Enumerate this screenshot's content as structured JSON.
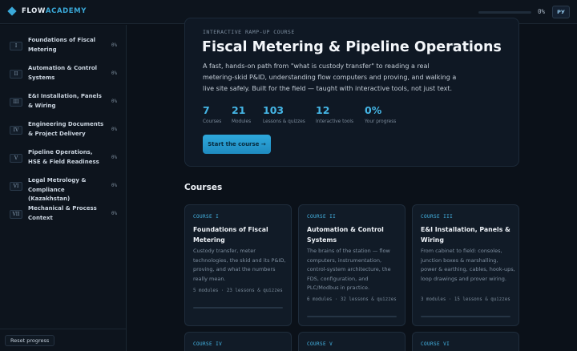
{
  "header": {
    "brand_main": "FLOW",
    "brand_accent": "ACADEMY",
    "progress_percent": 0,
    "progress_label": "0%",
    "lang_label": "РУ"
  },
  "sidebar": {
    "items": [
      {
        "num": "I",
        "label": "Foundations of Fiscal Metering",
        "pct": "0%"
      },
      {
        "num": "II",
        "label": "Automation & Control Systems",
        "pct": "0%"
      },
      {
        "num": "III",
        "label": "E&I Installation, Panels & Wiring",
        "pct": "0%"
      },
      {
        "num": "IV",
        "label": "Engineering Documents & Project Delivery",
        "pct": "0%"
      },
      {
        "num": "V",
        "label": "Pipeline Operations, HSE & Field Readiness",
        "pct": "0%"
      },
      {
        "num": "VI",
        "label": "Legal Metrology & Compliance (Kazakhstan)",
        "pct": "0%"
      },
      {
        "num": "VII",
        "label": "Mechanical & Process Context",
        "pct": "0%"
      }
    ],
    "reset_label": "Reset progress"
  },
  "hero": {
    "eyebrow": "INTERACTIVE RAMP-UP COURSE",
    "title": "Fiscal Metering & Pipeline Operations",
    "description": "A fast, hands-on path from \"what is custody transfer\" to reading a real metering-skid P&ID, understanding flow computers and proving, and walking a live site safely. Built for the field — taught with interactive tools, not just text.",
    "stats": [
      {
        "value": "7",
        "label": "Courses"
      },
      {
        "value": "21",
        "label": "Modules"
      },
      {
        "value": "103",
        "label": "Lessons & quizzes"
      },
      {
        "value": "12",
        "label": "Interactive tools"
      },
      {
        "value": "0%",
        "label": "Your progress"
      }
    ],
    "cta_label": "Start the course →"
  },
  "courses": {
    "section_title": "Courses",
    "cards": [
      {
        "code": "COURSE I",
        "title": "Foundations of Fiscal Metering",
        "desc": "Custody transfer, meter technologies, the skid and its P&ID, proving, and what the numbers really mean.",
        "meta": "5 modules · 23 lessons & quizzes",
        "progress": 0
      },
      {
        "code": "COURSE II",
        "title": "Automation & Control Systems",
        "desc": "The brains of the station — flow computers, instrumentation, control-system architecture, the FDS, configuration, and PLC/Modbus in practice.",
        "meta": "6 modules · 32 lessons & quizzes",
        "progress": 0
      },
      {
        "code": "COURSE III",
        "title": "E&I Installation, Panels & Wiring",
        "desc": "From cabinet to field: consoles, junction boxes & marshalling, power & earthing, cables, hook-ups, loop drawings and prover wiring.",
        "meta": "3 modules · 15 lessons & quizzes",
        "progress": 0
      },
      {
        "code": "COURSE IV"
      },
      {
        "code": "COURSE V"
      },
      {
        "code": "COURSE VI"
      }
    ]
  },
  "colors": {
    "accent": "#3aa9d9",
    "background": "#0b1119",
    "panel": "#0d141d",
    "card": "#111b27"
  },
  "icons": {
    "brand": "diamond-icon"
  }
}
